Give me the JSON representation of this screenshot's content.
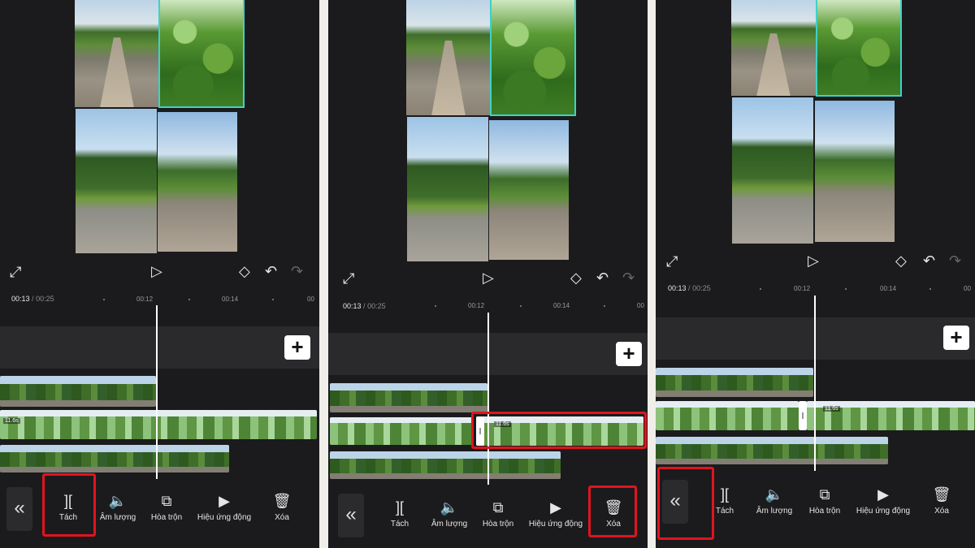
{
  "time_current": "00:13",
  "time_sep": "/",
  "time_total": "00:25",
  "ticks": [
    "00:12",
    "00:14"
  ],
  "tick_partial": "00",
  "clip_duration": "11.6s",
  "add_symbol": "+",
  "back_symbol": "«",
  "tools": [
    {
      "label": "Tách",
      "icon": "split-icon",
      "glyph": "]["
    },
    {
      "label": "Âm lượng",
      "icon": "volume-icon",
      "glyph": "🔈"
    },
    {
      "label": "Hòa trộn",
      "icon": "blend-icon",
      "glyph": "⧉"
    },
    {
      "label": "Hiệu ứng động",
      "icon": "animation-icon",
      "glyph": "▶"
    },
    {
      "label": "Xóa",
      "icon": "trash-icon",
      "glyph": "🗑"
    }
  ],
  "controls": {
    "fullscreen": "⤢",
    "play": "▷",
    "keyframe": "◇",
    "undo": "↶",
    "redo": "↷"
  },
  "highlight_color": "#e0141e"
}
